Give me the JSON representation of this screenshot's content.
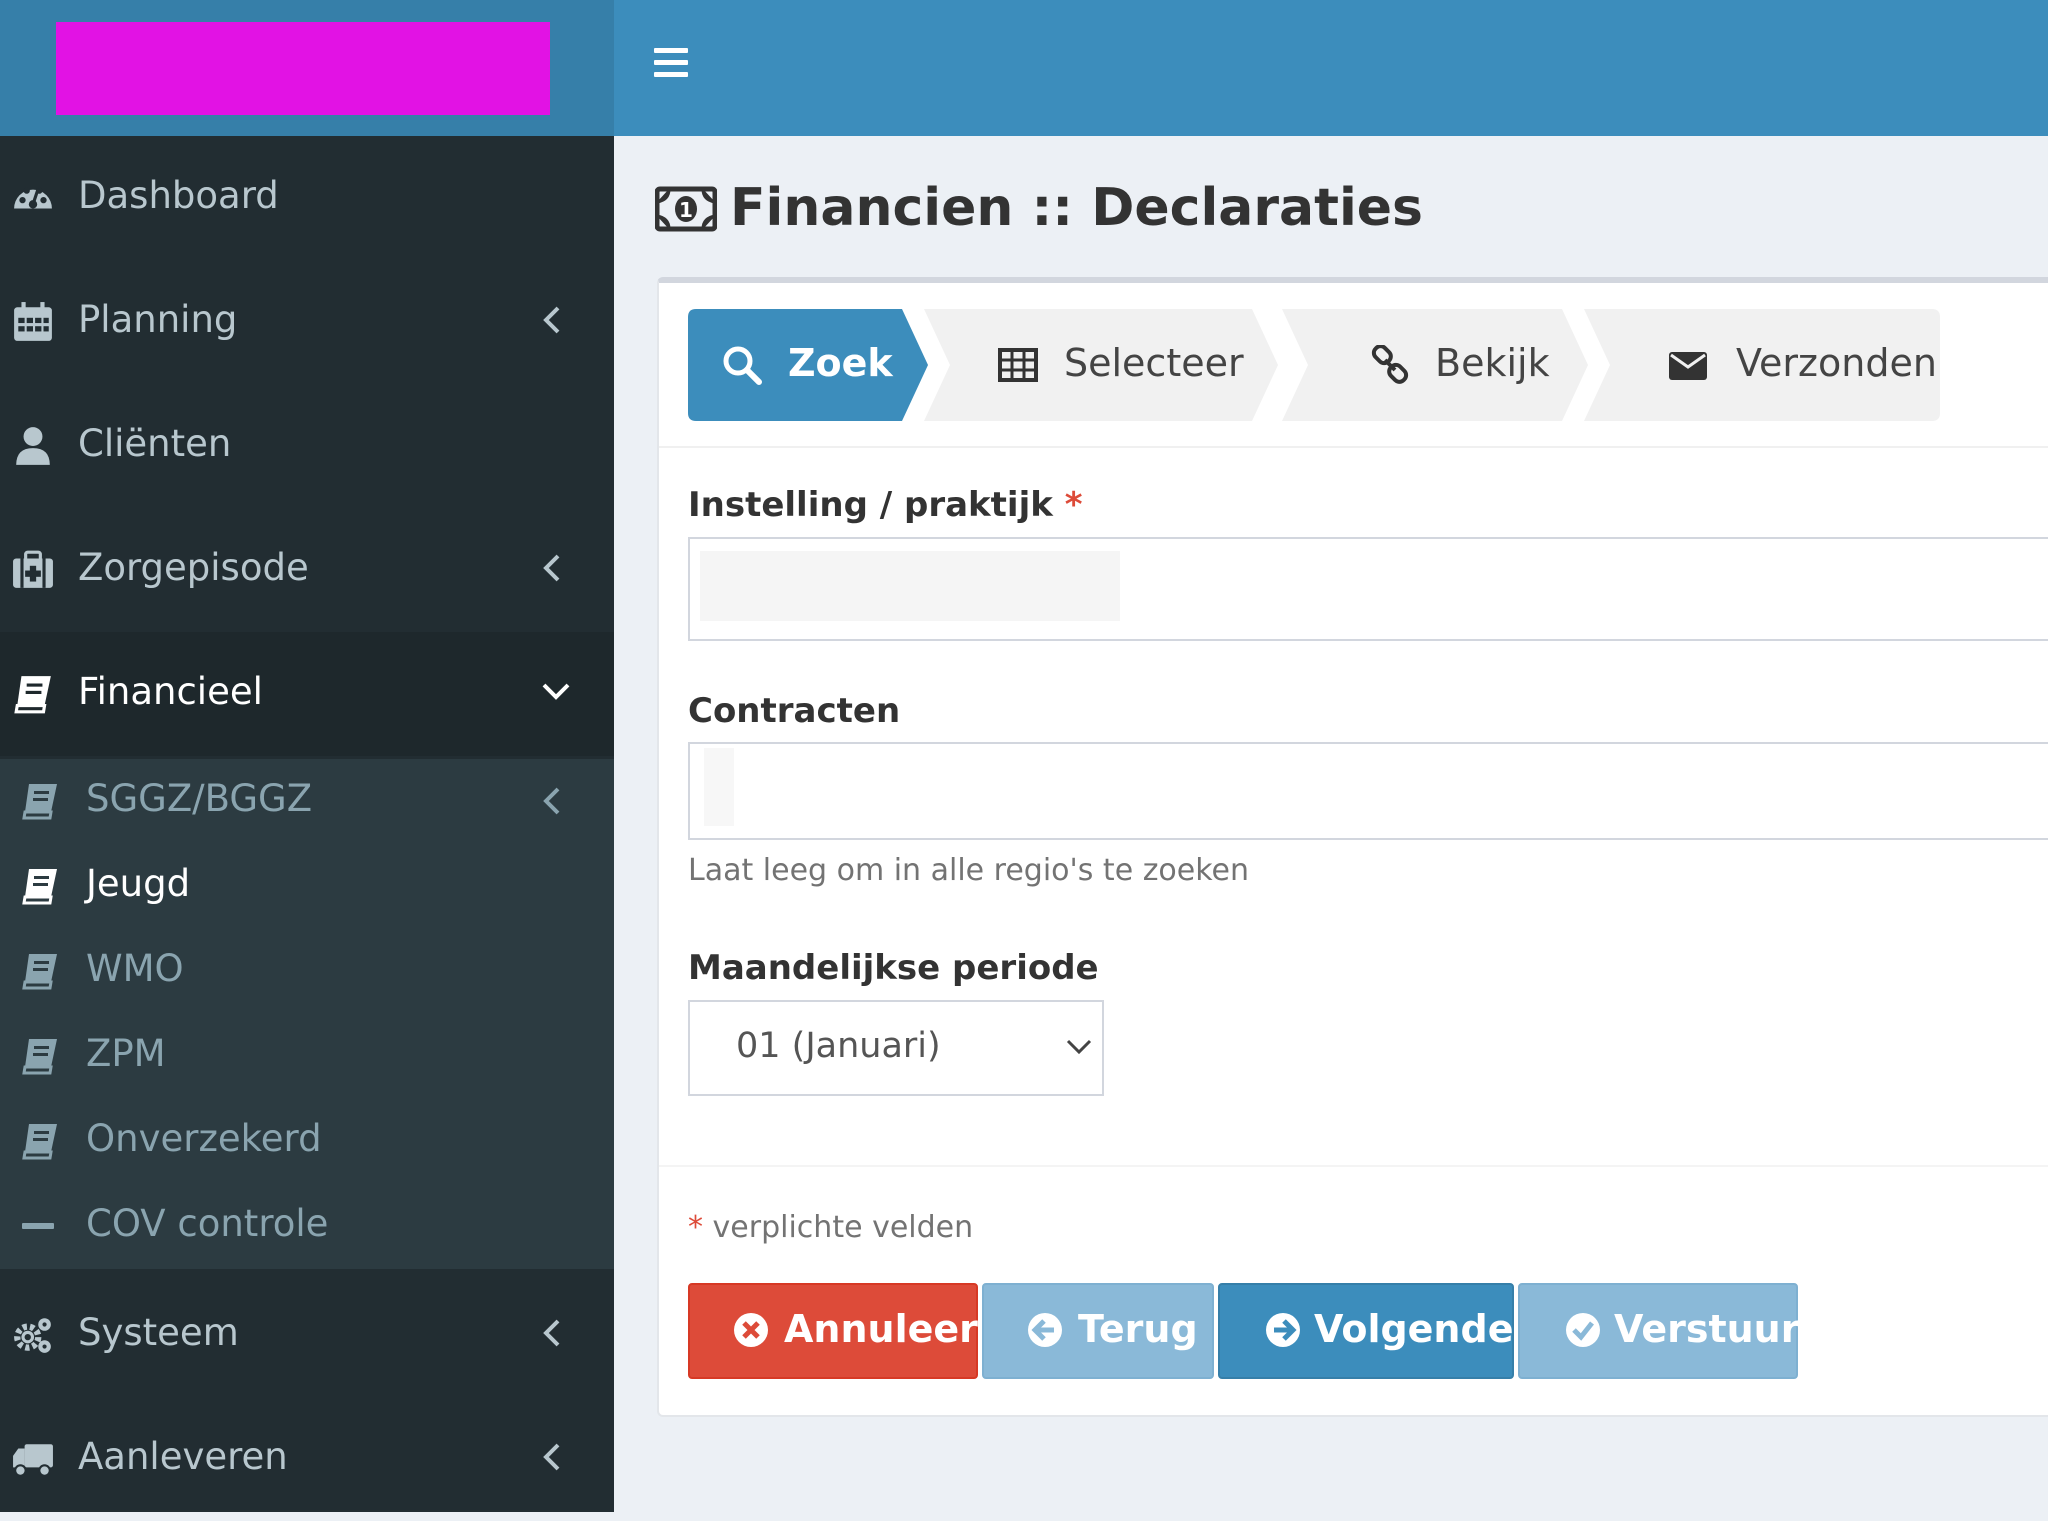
{
  "sidebar": {
    "items": [
      {
        "label": "Dashboard",
        "icon": "dashboard-icon"
      },
      {
        "label": "Planning",
        "icon": "calendar-icon"
      },
      {
        "label": "Cliënten",
        "icon": "user-icon"
      },
      {
        "label": "Zorgepisode",
        "icon": "medkit-icon"
      },
      {
        "label": "Financieel",
        "icon": "book-icon"
      },
      {
        "label": "Systeem",
        "icon": "cogs-icon"
      },
      {
        "label": "Aanleveren",
        "icon": "truck-icon"
      }
    ],
    "submenu": [
      {
        "label": "SGGZ/BGGZ",
        "icon": "book-icon"
      },
      {
        "label": "Jeugd",
        "icon": "book-icon"
      },
      {
        "label": "WMO",
        "icon": "book-icon"
      },
      {
        "label": "ZPM",
        "icon": "book-icon"
      },
      {
        "label": "Onverzekerd",
        "icon": "book-icon"
      },
      {
        "label": "COV controle",
        "icon": "minus-icon"
      }
    ]
  },
  "page": {
    "title": "Financien :: Declaraties",
    "title_icon": "money-icon"
  },
  "wizard": {
    "steps": [
      {
        "label": "Zoek",
        "icon": "search-icon"
      },
      {
        "label": "Selecteer",
        "icon": "table-icon"
      },
      {
        "label": "Bekijk",
        "icon": "link-icon"
      },
      {
        "label": "Verzonden",
        "icon": "envelope-icon"
      }
    ]
  },
  "form": {
    "instelling_label": "Instelling / praktijk",
    "required_mark": "*",
    "contracten_label": "Contracten",
    "contracten_help": "Laat leeg om in alle regio's te zoeken",
    "periode_label": "Maandelijkse periode",
    "periode_value": "01 (Januari)",
    "required_note": "verplichte velden"
  },
  "buttons": {
    "cancel": "Annuleer",
    "back": "Terug",
    "next": "Volgende",
    "send": "Verstuur"
  },
  "colors": {
    "header": "#3c8dbc",
    "logo_placeholder": "#e212e4",
    "sidebar": "#222d32",
    "danger": "#dd4b39",
    "primary": "#3c8dbc",
    "primary_disabled": "#8ab9d8"
  }
}
